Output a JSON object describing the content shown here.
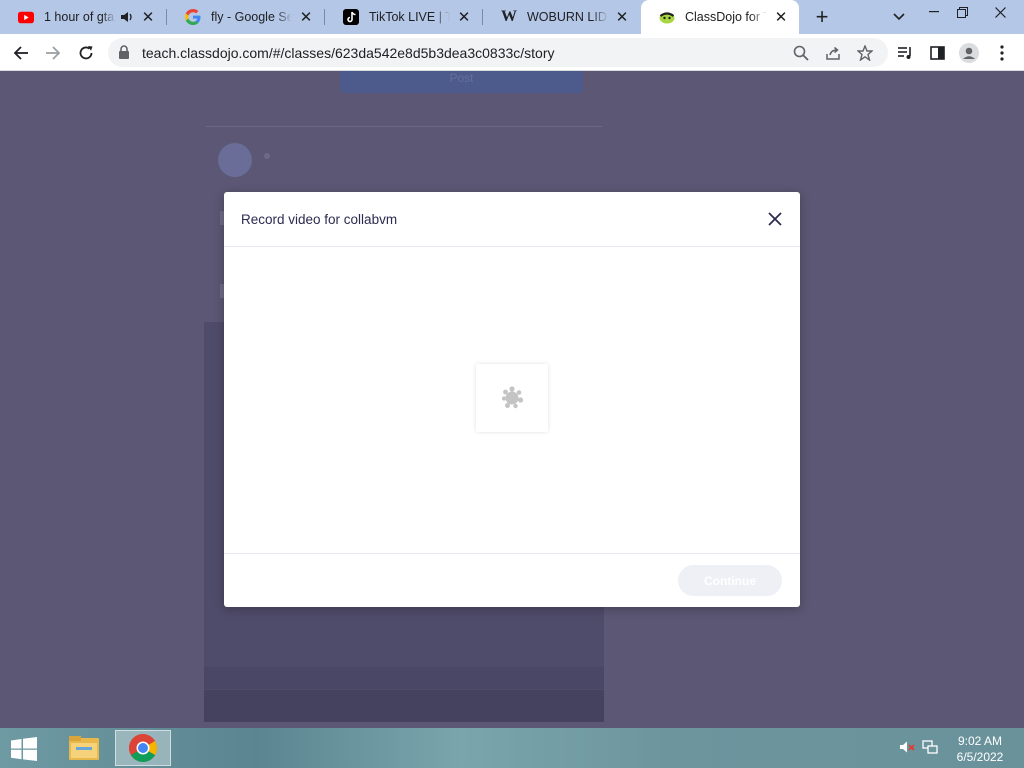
{
  "browser": {
    "tabs": [
      {
        "title": "1 hour of gta",
        "favicon": "youtube-icon",
        "audio": true,
        "active": false
      },
      {
        "title": "fly - Google Search",
        "favicon": "google-icon",
        "audio": false,
        "active": false
      },
      {
        "title": "TikTok LIVE | TikTok",
        "favicon": "tiktok-icon",
        "audio": false,
        "active": false
      },
      {
        "title": "WOBURN LIDO -",
        "favicon": "wikipedia-icon",
        "audio": false,
        "active": false
      },
      {
        "title": "ClassDojo for Teachers",
        "favicon": "classdojo-icon",
        "audio": false,
        "active": true
      }
    ],
    "url": "teach.classdojo.com/#/classes/623da542e8d5b3dea3c0833c/story"
  },
  "background_page": {
    "top_button_label": "Post"
  },
  "modal": {
    "title": "Record video for collabvm",
    "continue_label": "Continue",
    "state": "loading"
  },
  "taskbar": {
    "apps": [
      "file-explorer",
      "google-chrome"
    ],
    "active_app": "google-chrome",
    "time": "9:02 AM",
    "date": "6/5/2022"
  },
  "colors": {
    "tabstrip": "#b4c7e7",
    "overlay": "#5b5774",
    "modal_title": "#2c2a50"
  }
}
